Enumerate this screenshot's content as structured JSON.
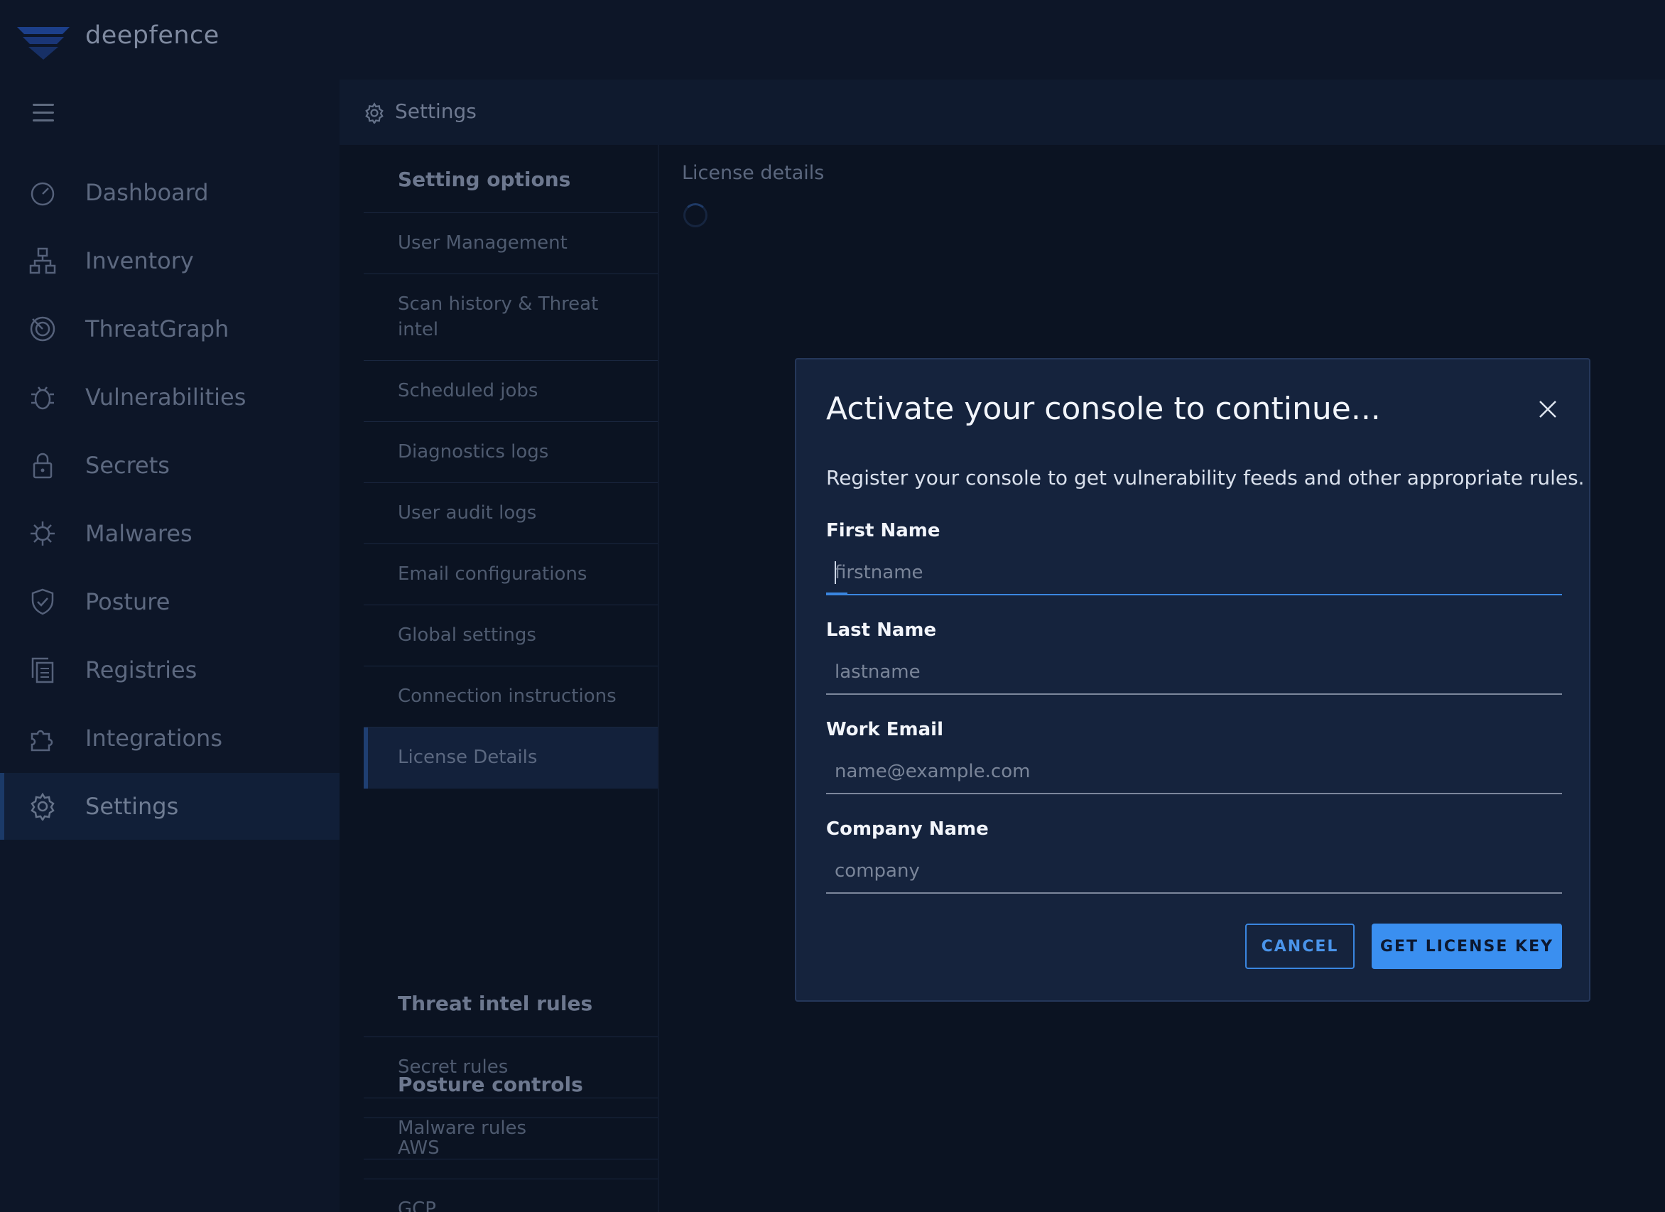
{
  "app": {
    "brand": "deepfence"
  },
  "header": {
    "title": "Settings"
  },
  "sidebar": {
    "items": [
      {
        "label": "Dashboard",
        "icon": "dashboard-icon"
      },
      {
        "label": "Inventory",
        "icon": "inventory-icon"
      },
      {
        "label": "ThreatGraph",
        "icon": "threatgraph-icon"
      },
      {
        "label": "Vulnerabilities",
        "icon": "bug-icon"
      },
      {
        "label": "Secrets",
        "icon": "lock-icon"
      },
      {
        "label": "Malwares",
        "icon": "malware-icon"
      },
      {
        "label": "Posture",
        "icon": "shield-icon"
      },
      {
        "label": "Registries",
        "icon": "registries-icon"
      },
      {
        "label": "Integrations",
        "icon": "puzzle-icon"
      },
      {
        "label": "Settings",
        "icon": "gear-icon",
        "active": true
      }
    ]
  },
  "options": {
    "sections": [
      {
        "title": "Setting options"
      },
      {
        "title": "Threat intel rules"
      },
      {
        "title": "Posture controls"
      }
    ],
    "items": [
      "User Management",
      "Scan history & Threat intel",
      "Scheduled jobs",
      "Diagnostics logs",
      "User audit logs",
      "Email configurations",
      "Global settings",
      "Connection instructions",
      "License Details",
      "Secret rules",
      "Malware rules",
      "AWS",
      "GCP"
    ],
    "active": "License Details"
  },
  "main": {
    "title": "License details"
  },
  "modal": {
    "title": "Activate your console to continue...",
    "description": "Register your console to get vulnerability feeds and other appropriate rules.",
    "fields": [
      {
        "label": "First Name",
        "placeholder": "firstname",
        "value": ""
      },
      {
        "label": "Last Name",
        "placeholder": "lastname",
        "value": ""
      },
      {
        "label": "Work Email",
        "placeholder": "name@example.com",
        "value": ""
      },
      {
        "label": "Company Name",
        "placeholder": "company",
        "value": ""
      }
    ],
    "cancel_label": "CANCEL",
    "submit_label": "GET LICENSE KEY"
  },
  "colors": {
    "accent": "#3a8ff0",
    "background": "#0b1322",
    "modal": "#15233d"
  }
}
